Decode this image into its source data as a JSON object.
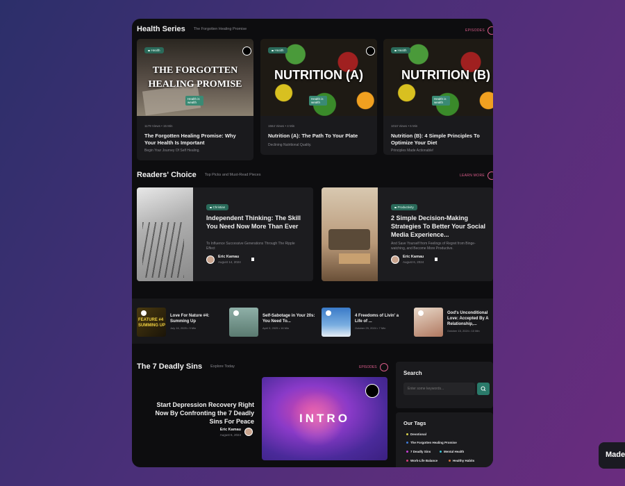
{
  "health_series": {
    "title": "Health Series",
    "subtitle": "The Forgotten Healing Promise",
    "link": "EPISODES",
    "cards": [
      {
        "tag": "Health",
        "image_text": "THE FORGOTTEN HEALING PROMISE",
        "badge": "Health is wealth",
        "views": "1179 Views",
        "dot": "•",
        "read": "15 Min",
        "title": "The Forgotten Healing Promise: Why Your Health Is Important",
        "desc": "Begin Your Journey Of Self Healing."
      },
      {
        "tag": "Health",
        "image_text": "NUTRITION (A)",
        "badge": "Health is wealth",
        "views": "1564 Views",
        "dot": "•",
        "read": "4 Min",
        "title": "Nutrition (A): The Path To Your Plate",
        "desc": "Declining Nutritional Quality."
      },
      {
        "tag": "Health",
        "image_text": "NUTRITION (B)",
        "badge": "Health is wealth",
        "views": "1010 Views",
        "dot": "•",
        "read": "6 Min",
        "title": "Nutrition (B): 4 Simple Principles To Optimize Your Diet",
        "desc": "Principles Made Actionable!"
      }
    ]
  },
  "readers_choice": {
    "title": "Readers' Choice",
    "subtitle": "Top Picks and Must-Read Pieces",
    "link": "LEARN MORE",
    "cards": [
      {
        "tag": "Christian",
        "title": "Independent Thinking: The Skill You Need Now More Than Ever",
        "desc": "To Influence Successive Generations Through The Ripple Effect",
        "author": "Eric Kamau",
        "date": "August 14, 2024"
      },
      {
        "tag": "Productivity",
        "title": "2 Simple Decision-Making Strategies To Better Your Social Media Experience...",
        "desc": "And Save Yourself from Feelings of Regret from Binge-watching, and Become More Productive.",
        "author": "Eric Kamau",
        "date": "August 6, 2024"
      }
    ]
  },
  "strip": [
    {
      "thumb_text": "FEATURE #4 SUMMING UP",
      "title": "Love For Nature #4: Summing Up",
      "date": "July 16, 2025",
      "dot": "•",
      "read": "9 Min"
    },
    {
      "title": "Self-Sabotage in Your 20s: You Need To...",
      "date": "April 9, 2025",
      "dot": "•",
      "read": "16 Min"
    },
    {
      "title": "4 Freedoms of Livin' a Life of ...",
      "date": "October 29, 2024",
      "dot": "•",
      "read": "7 Min"
    },
    {
      "title": "God's Unconditional Love: Accepted By A Relationship,...",
      "date": "October 15, 2024",
      "dot": "•",
      "read": "10 Min"
    }
  ],
  "deadly_sins": {
    "title": "The 7 Deadly Sins",
    "subtitle": "Explore Today",
    "link": "EPISODES",
    "feature_title": "Start Depression Recovery Right Now By Confronting the 7 Deadly Sins For Peace",
    "author": "Eric Kamau",
    "date": "August 6, 2024",
    "image_text": "INTRO"
  },
  "search": {
    "title": "Search",
    "placeholder": "Enter some keywords..."
  },
  "tags": {
    "title": "Our Tags",
    "items": [
      {
        "label": "Devotional",
        "color": "#d6d04a"
      },
      {
        "label": "The Forgotten Healing Promise",
        "color": "#3e7bd6"
      },
      {
        "label": "7 Deadly Sins",
        "color": "#c93ed6"
      },
      {
        "label": "Mental Health",
        "color": "#3ec4d6"
      },
      {
        "label": "Work-Life Balance",
        "color": "#d63e7b"
      },
      {
        "label": "Healthy Habits",
        "color": "#d6703e"
      }
    ]
  },
  "made_button": "Made"
}
